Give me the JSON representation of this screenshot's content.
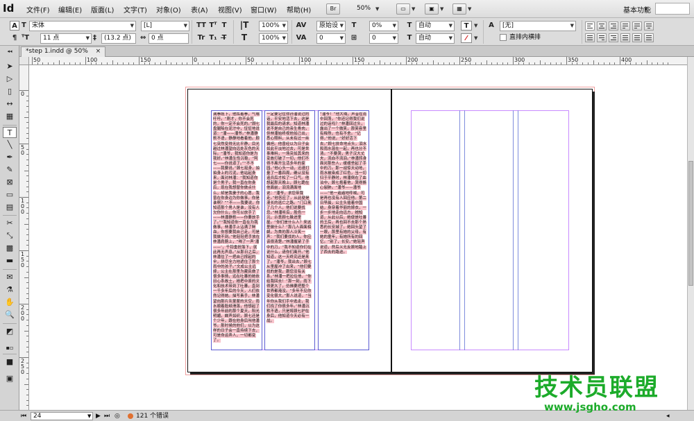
{
  "app": {
    "logo": "Id",
    "workspace": "基本功能",
    "zoom": "50%",
    "bridge_label": "Br"
  },
  "menu": [
    "文件(F)",
    "编辑(E)",
    "版面(L)",
    "文字(T)",
    "对象(O)",
    "表(A)",
    "视图(V)",
    "窗口(W)",
    "帮助(H)"
  ],
  "control": {
    "font_family": "宋体",
    "font_style": "[L]",
    "font_size": "11 点",
    "leading": "(13.2 点)",
    "tracking_value": "0 点",
    "h_scale": "100%",
    "v_scale": "100%",
    "kerning": "原始设",
    "tracking": "0",
    "baseline": "0%",
    "skew": "0",
    "auto1": "自动",
    "auto2": "自动",
    "char_style": "[无]",
    "checkbox_label": "直排内横排"
  },
  "document": {
    "tab_title": "*step 1.indd @ 50%",
    "close": "×"
  },
  "ruler": {
    "h_labels": [
      "50",
      "100",
      "150",
      "0",
      "50",
      "100",
      "150",
      "200",
      "250",
      "300",
      "350",
      "400"
    ],
    "v_labels": [
      "0",
      "5 0",
      "1 0 0",
      "1 5 0",
      "2 0 0",
      "2 5 0"
    ]
  },
  "story": {
    "col1": "满拳既下，他挥着拳，气喘吁吁。“刚才，你不会死的，你一定不会死的。”顾七盘腿陷在泥泞中，怔怔地说道：“潘——潘爷。”林潘静默不语，静静地看着他。顾七突然变得无比平静，目光越过林潘望向远处灰色的天际。“潘爷，我知道你是为我好。”林潘生性沉稳，“阿七——你说道了。”“不不——我要说。”顾七挺身，拍拍身上的污泥，他站起身来，面对林潘：“我知道你是个男子，我一直在你身后，现在我想替你做点什么，却是我妻子的心愿，我曾在你身边为你做事，你是谁啊？”“不——我要说，你知道那个男人是谁，没有人欠你什么，你可以放手了——林潘静默——你要放手了。”“我知道你一直在为我做事，林潘手上沾满了鲜血，你想要我自己走，可是我做不到。”他轻轻把手放在林潘肩膀上，“喝了一声‘潘——’，千钧重担落下，就此再无声息。”从那日之后，林潘住了一把自己撑起的伞，拼尽全力地遮住了那个雨中的孩子。”文成公主远嫁，公主在那里为藏民做了很多事情，远在吐蕃的她依旧心系故土，她把中原的文化和技术带到了吐蕃，直到一千多年后的今天，人们依然记得她。描写素手，林潘望向那片灰蒙蒙的天空，雨水顺着脸颊滑落，他想起了很多年前的那个夏天，阳光明媚，蝉声如织，顾七还是个少年，跟在他身后叫他潘爷。那时候的他们，以为这样的日子会一直持续下去，可是命运弄人，一切都变了。",
    "col2": "一定要记住你孙潘说过的话，平安地活下去，这是我最后的请求。知道林潘说不是自己的亲生骨肉，但林潘始终视他如己出，悉心照料，从未有过一丝偏袒。他曾经以为日子会如此平淡地过去，可是世事难料，一场突如其来的变故打破了一切，他们不得不离开生活多年的家园。”他心头一动，迅速打量了一番四周，确认没有追兵后才松了一口气。他想起那天晚上，顾七跪在他面前，泪流满面地说：“潘爷，求您带我走。”他答应了，从此便是漫长的逃亡之路。“门口来了几个人，他们说要找您。”林潘听后，脸色一沉，示意顾七躲进里屋。“你们是什么人？来这里做什么？”那几人面面相觑，为首的那人冷笑一声：“我们要找的人，你应该很清楚。”林潘握紧了手中的刀，“我不知道你们在说什么，请你们离开。”他知道，这一天终究还是来了。“潘爷，我出去，”顾七从里屋冲了出来，“他们要找的是我，跟您没有关系。”林潘一把拉住他，“你给我回去！”那一刻，雨下得更大了，仿佛要把整个世界都淹没。“多年不见你变化很大，”那人说道，“当年你从我们手中逃走，我们找了你很多年。”林潘沉默不语，只是将顾七护在身后，他知道今天必有一战。",
    "col3": "“潘爷！”他大喊，声音在雨中回荡，“你还记得我们说过的话吗？”林潘回过头，露出了一个微笑，那笑容里有释然，也有不舍。“记得，”他说，“好好活下去。”顾七拼命地点头，泪水和雨水混在一起，再也分不清。“不要哭，男子汉大丈夫，流血不流泪。”林潘转身面对那些人，缓缓举起了手中的刀。那一战惊天动地，雨水被染成了红色，当一切归于平静时，林潘倒在了血泊中，顾七抱着他，哭得撕心裂肺。“潘爷——潘爷——”他一遍遍地呼喊，可是再也没有人回应他。第二日早晨，公主头插着中国结，身穿着华丽的嫁衣，一步一步地走向远方，她知道，从此以后，她便是吐蕃的王后，再也回不去那个熟悉的长安城了。她回头望了一眼，那里有她的父母，有她的童年，有她所有的回忆。“别了，长安。”她轻声说道，然后义无反顾地踏上了西去的路途。"
  },
  "status": {
    "page": "24",
    "errors": "121 个错误"
  },
  "watermark": {
    "main": "技术员联盟",
    "url": "www.jsgho.com"
  }
}
